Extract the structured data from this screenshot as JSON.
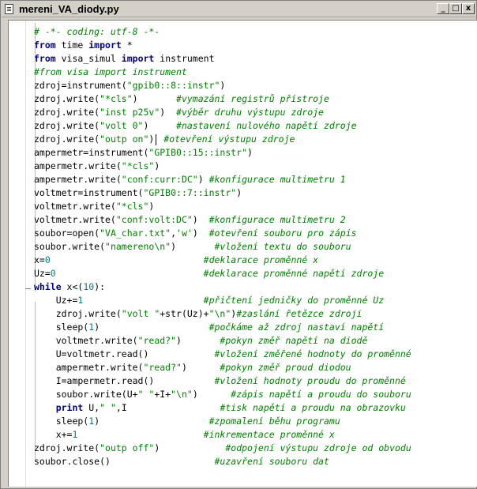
{
  "window": {
    "title": "mereni_VA_diody.py",
    "controls": {
      "minimize": "_",
      "restore": "□",
      "close": "x"
    }
  },
  "code_lines": [
    [
      {
        "t": "cm",
        "v": "# -*- coding: utf-8 -*-"
      }
    ],
    [
      {
        "t": "kw",
        "v": "from"
      },
      {
        "t": "op",
        "v": " time "
      },
      {
        "t": "kw",
        "v": "import"
      },
      {
        "t": "op",
        "v": " *"
      }
    ],
    [
      {
        "t": "kw",
        "v": "from"
      },
      {
        "t": "op",
        "v": " visa_simul "
      },
      {
        "t": "kw",
        "v": "import"
      },
      {
        "t": "op",
        "v": " instrument"
      }
    ],
    [
      {
        "t": "cm",
        "v": "#from visa import instrument"
      }
    ],
    [
      {
        "t": "op",
        "v": "zdroj=instrument("
      },
      {
        "t": "str",
        "v": "\"gpib0::8::instr\""
      },
      {
        "t": "op",
        "v": ")"
      }
    ],
    [
      {
        "t": "op",
        "v": "zdroj.write("
      },
      {
        "t": "str",
        "v": "\"*cls\""
      },
      {
        "t": "op",
        "v": ")       "
      },
      {
        "t": "cm",
        "v": "#vymazání registrů přístroje"
      }
    ],
    [
      {
        "t": "op",
        "v": "zdroj.write("
      },
      {
        "t": "str",
        "v": "\"inst p25v\""
      },
      {
        "t": "op",
        "v": ")  "
      },
      {
        "t": "cm",
        "v": "#výběr druhu výstupu zdroje"
      }
    ],
    [
      {
        "t": "op",
        "v": "zdroj.write("
      },
      {
        "t": "str",
        "v": "\"volt 0\""
      },
      {
        "t": "op",
        "v": ")     "
      },
      {
        "t": "cm",
        "v": "#nastavení nulového napětí zdroje"
      }
    ],
    [
      {
        "t": "op",
        "v": "zdroj.write("
      },
      {
        "t": "str",
        "v": "\"outp on\""
      },
      {
        "t": "op",
        "v": ")"
      },
      {
        "t": "caret",
        "v": ""
      },
      {
        "t": "op",
        "v": " "
      },
      {
        "t": "cm",
        "v": "#otevření výstupu zdroje"
      }
    ],
    [
      {
        "t": "op",
        "v": "ampermetr=instrument("
      },
      {
        "t": "str",
        "v": "\"GPIB0::15::instr\""
      },
      {
        "t": "op",
        "v": ")"
      }
    ],
    [
      {
        "t": "op",
        "v": "ampermetr.write("
      },
      {
        "t": "str",
        "v": "\"*cls\""
      },
      {
        "t": "op",
        "v": ")"
      }
    ],
    [
      {
        "t": "op",
        "v": "ampermetr.write("
      },
      {
        "t": "str",
        "v": "\"conf:curr:DC\""
      },
      {
        "t": "op",
        "v": ") "
      },
      {
        "t": "cm",
        "v": "#konfigurace multimetru 1"
      }
    ],
    [
      {
        "t": "op",
        "v": "voltmetr=instrument("
      },
      {
        "t": "str",
        "v": "\"GPIB0::7::instr\""
      },
      {
        "t": "op",
        "v": ")"
      }
    ],
    [
      {
        "t": "op",
        "v": "voltmetr.write("
      },
      {
        "t": "str",
        "v": "\"*cls\""
      },
      {
        "t": "op",
        "v": ")"
      }
    ],
    [
      {
        "t": "op",
        "v": "voltmetr.write("
      },
      {
        "t": "str",
        "v": "\"conf:volt:DC\""
      },
      {
        "t": "op",
        "v": ")  "
      },
      {
        "t": "cm",
        "v": "#konfigurace multimetru 2"
      }
    ],
    [
      {
        "t": "op",
        "v": "soubor=open("
      },
      {
        "t": "str",
        "v": "\"VA_char.txt\""
      },
      {
        "t": "op",
        "v": ","
      },
      {
        "t": "str",
        "v": "'w'"
      },
      {
        "t": "op",
        "v": ")  "
      },
      {
        "t": "cm",
        "v": "#otevření souboru pro zápis"
      }
    ],
    [
      {
        "t": "op",
        "v": "soubor.write("
      },
      {
        "t": "str",
        "v": "\"namereno\\n\""
      },
      {
        "t": "op",
        "v": ")       "
      },
      {
        "t": "cm",
        "v": "#vložení textu do souboru"
      }
    ],
    [
      {
        "t": "op",
        "v": "x="
      },
      {
        "t": "num",
        "v": "0"
      },
      {
        "t": "op",
        "v": "                            "
      },
      {
        "t": "cm",
        "v": "#deklarace proměnné x"
      }
    ],
    [
      {
        "t": "op",
        "v": "Uz="
      },
      {
        "t": "num",
        "v": "0"
      },
      {
        "t": "op",
        "v": "                           "
      },
      {
        "t": "cm",
        "v": "#deklarace proměnné napětí zdroje"
      }
    ],
    [
      {
        "t": "kw",
        "v": "while"
      },
      {
        "t": "op",
        "v": " x<("
      },
      {
        "t": "num",
        "v": "10"
      },
      {
        "t": "op",
        "v": "):"
      }
    ],
    [
      {
        "t": "op",
        "v": "    Uz+="
      },
      {
        "t": "num",
        "v": "1"
      },
      {
        "t": "op",
        "v": "                      "
      },
      {
        "t": "cm",
        "v": "#přičtení jedničky do proměnné Uz"
      }
    ],
    [
      {
        "t": "op",
        "v": "    zdroj.write("
      },
      {
        "t": "str",
        "v": "\"volt \""
      },
      {
        "t": "op",
        "v": "+str(Uz)+"
      },
      {
        "t": "str",
        "v": "\"\\n\""
      },
      {
        "t": "op",
        "v": ")"
      },
      {
        "t": "cm",
        "v": "#zaslání řetězce zdroji"
      }
    ],
    [
      {
        "t": "op",
        "v": "    sleep("
      },
      {
        "t": "num",
        "v": "1"
      },
      {
        "t": "op",
        "v": ")                    "
      },
      {
        "t": "cm",
        "v": "#počkáme až zdroj nastaví napětí"
      }
    ],
    [
      {
        "t": "op",
        "v": "    voltmetr.write("
      },
      {
        "t": "str",
        "v": "\"read?\""
      },
      {
        "t": "op",
        "v": ")       "
      },
      {
        "t": "cm",
        "v": "#pokyn změř napětí na diodě"
      }
    ],
    [
      {
        "t": "op",
        "v": "    U=voltmetr.read()            "
      },
      {
        "t": "cm",
        "v": "#vložení změřené hodnoty do proměnné"
      }
    ],
    [
      {
        "t": "op",
        "v": "    ampermetr.write("
      },
      {
        "t": "str",
        "v": "\"read?\""
      },
      {
        "t": "op",
        "v": ")      "
      },
      {
        "t": "cm",
        "v": "#pokyn změř proud diodou"
      }
    ],
    [
      {
        "t": "op",
        "v": "    I=ampermetr.read()           "
      },
      {
        "t": "cm",
        "v": "#vložení hodnoty proudu do proměnné"
      }
    ],
    [
      {
        "t": "op",
        "v": "    soubor.write(U+"
      },
      {
        "t": "str",
        "v": "\" \""
      },
      {
        "t": "op",
        "v": "+I+"
      },
      {
        "t": "str",
        "v": "\"\\n\""
      },
      {
        "t": "op",
        "v": ")      "
      },
      {
        "t": "cm",
        "v": "#zápis napětí a proudu do souboru"
      }
    ],
    [
      {
        "t": "op",
        "v": "    "
      },
      {
        "t": "kw",
        "v": "print"
      },
      {
        "t": "op",
        "v": " U,"
      },
      {
        "t": "str",
        "v": "\" \""
      },
      {
        "t": "op",
        "v": ",I                 "
      },
      {
        "t": "cm",
        "v": "#tisk napětí a proudu na obrazovku"
      }
    ],
    [
      {
        "t": "op",
        "v": "    sleep("
      },
      {
        "t": "num",
        "v": "1"
      },
      {
        "t": "op",
        "v": ")                    "
      },
      {
        "t": "cm",
        "v": "#zpomalení běhu programu"
      }
    ],
    [
      {
        "t": "op",
        "v": "    x+="
      },
      {
        "t": "num",
        "v": "1"
      },
      {
        "t": "op",
        "v": "                       "
      },
      {
        "t": "cm",
        "v": "#inkrementace proměnné x"
      }
    ],
    [
      {
        "t": "op",
        "v": "zdroj.write("
      },
      {
        "t": "str",
        "v": "\"outp off\""
      },
      {
        "t": "op",
        "v": ")            "
      },
      {
        "t": "cm",
        "v": "#odpojení výstupu zdroje od obvodu"
      }
    ],
    [
      {
        "t": "op",
        "v": "soubor.close()                   "
      },
      {
        "t": "cm",
        "v": "#uzavření souboru dat"
      }
    ]
  ]
}
